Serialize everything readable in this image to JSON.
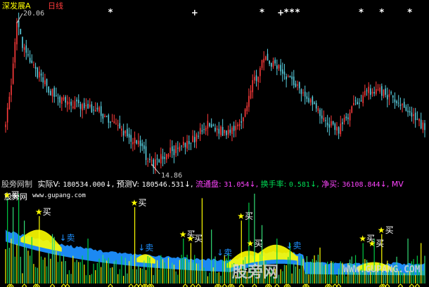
{
  "header": {
    "stock_name": "深发展A",
    "period": "日线"
  },
  "colors": {
    "up": "#ff3b3b",
    "down": "#5ad0e0",
    "background": "#000000",
    "yellow": "#ffff00",
    "green": "#00cc44",
    "blue": "#1e90ff",
    "magenta": "#ff44ff"
  },
  "price_panel": {
    "high_label": "20.06",
    "low_label": "14.86",
    "markers": [
      {
        "symbol": "*",
        "bar": 56
      },
      {
        "symbol": "+",
        "bar": 101
      },
      {
        "symbol": "*",
        "bar": 137
      },
      {
        "symbol": "+",
        "bar": 147
      },
      {
        "symbol": "*",
        "bar": 150
      },
      {
        "symbol": "*",
        "bar": 153
      },
      {
        "symbol": "*",
        "bar": 156
      },
      {
        "symbol": "*",
        "bar": 190
      },
      {
        "symbol": "*",
        "bar": 201
      },
      {
        "symbol": "*",
        "bar": 216
      }
    ]
  },
  "info_bar": {
    "indicator_name": "股旁网制",
    "actual_label": "实际V:",
    "actual_value": "180534.000",
    "forecast_label": "预测V:",
    "forecast_value": "180546.531",
    "float_label": "流通盘:",
    "float_value": "31.054",
    "turnover_label": "换手率:",
    "turnover_value": "0.581",
    "net_buy_label": "净买:",
    "net_buy_value": "36108.844",
    "trailing": "MV"
  },
  "watermark": {
    "site_name": "股旁网",
    "site_url": "www.gupang.com",
    "big_text": "股旁网",
    "big_url": "WWW.GUPANG.COM"
  },
  "signals": [
    {
      "type": "buy",
      "star": true,
      "label": "买",
      "bar": 1
    },
    {
      "type": "buy",
      "star": true,
      "label": "买",
      "bar": 18
    },
    {
      "type": "sell",
      "star": false,
      "label": "↓卖",
      "bar": 31
    },
    {
      "type": "buy",
      "star": true,
      "label": "买",
      "bar": 69
    },
    {
      "type": "sell",
      "star": false,
      "label": "↓卖",
      "bar": 73
    },
    {
      "type": "buy",
      "star": true,
      "label": "买",
      "bar": 95
    },
    {
      "type": "buy",
      "star": true,
      "label": "买",
      "bar": 99
    },
    {
      "type": "sell",
      "star": false,
      "label": "↓卖",
      "bar": 115
    },
    {
      "type": "buy",
      "star": true,
      "label": "买",
      "bar": 126
    },
    {
      "type": "buy",
      "star": true,
      "label": "买",
      "bar": 131
    },
    {
      "type": "sell",
      "star": false,
      "label": "↓卖",
      "bar": 152
    },
    {
      "type": "buy",
      "star": true,
      "label": "买",
      "bar": 191
    },
    {
      "type": "buy",
      "star": true,
      "label": "买",
      "bar": 196
    },
    {
      "type": "buy",
      "star": true,
      "label": "买",
      "bar": 201
    }
  ],
  "chart_data": {
    "type": "candlestick",
    "series_count": 225,
    "y_range_price": [
      14.5,
      20.6
    ],
    "note_keypoints": "close price path keyed by bar index",
    "close_keypoints": [
      [
        0,
        16.5
      ],
      [
        3,
        17.6
      ],
      [
        6,
        20.06
      ],
      [
        10,
        19.0
      ],
      [
        15,
        18.4
      ],
      [
        22,
        17.7
      ],
      [
        30,
        17.2
      ],
      [
        40,
        17.0
      ],
      [
        50,
        16.8
      ],
      [
        62,
        16.1
      ],
      [
        72,
        15.5
      ],
      [
        78,
        14.86
      ],
      [
        88,
        15.3
      ],
      [
        98,
        15.6
      ],
      [
        108,
        16.3
      ],
      [
        118,
        16.0
      ],
      [
        126,
        16.5
      ],
      [
        132,
        17.8
      ],
      [
        138,
        18.7
      ],
      [
        146,
        18.4
      ],
      [
        154,
        17.9
      ],
      [
        162,
        17.3
      ],
      [
        170,
        16.5
      ],
      [
        178,
        16.1
      ],
      [
        186,
        17.0
      ],
      [
        194,
        17.6
      ],
      [
        202,
        17.5
      ],
      [
        210,
        17.1
      ],
      [
        216,
        16.8
      ],
      [
        224,
        16.2
      ]
    ],
    "volume_spikes": [
      [
        1,
        0.95
      ],
      [
        4,
        0.85
      ],
      [
        7,
        1.0
      ],
      [
        10,
        0.7
      ],
      [
        18,
        0.75
      ],
      [
        25,
        0.55
      ],
      [
        44,
        0.5
      ],
      [
        69,
        0.85
      ],
      [
        95,
        0.5
      ],
      [
        99,
        0.45
      ],
      [
        105,
        0.95
      ],
      [
        110,
        0.6
      ],
      [
        126,
        0.7
      ],
      [
        130,
        0.9
      ],
      [
        133,
        1.0
      ],
      [
        137,
        0.65
      ],
      [
        145,
        0.5
      ],
      [
        152,
        0.45
      ],
      [
        168,
        0.4
      ],
      [
        191,
        0.45
      ],
      [
        197,
        0.5
      ],
      [
        201,
        0.55
      ],
      [
        215,
        0.5
      ],
      [
        222,
        0.45
      ]
    ]
  }
}
